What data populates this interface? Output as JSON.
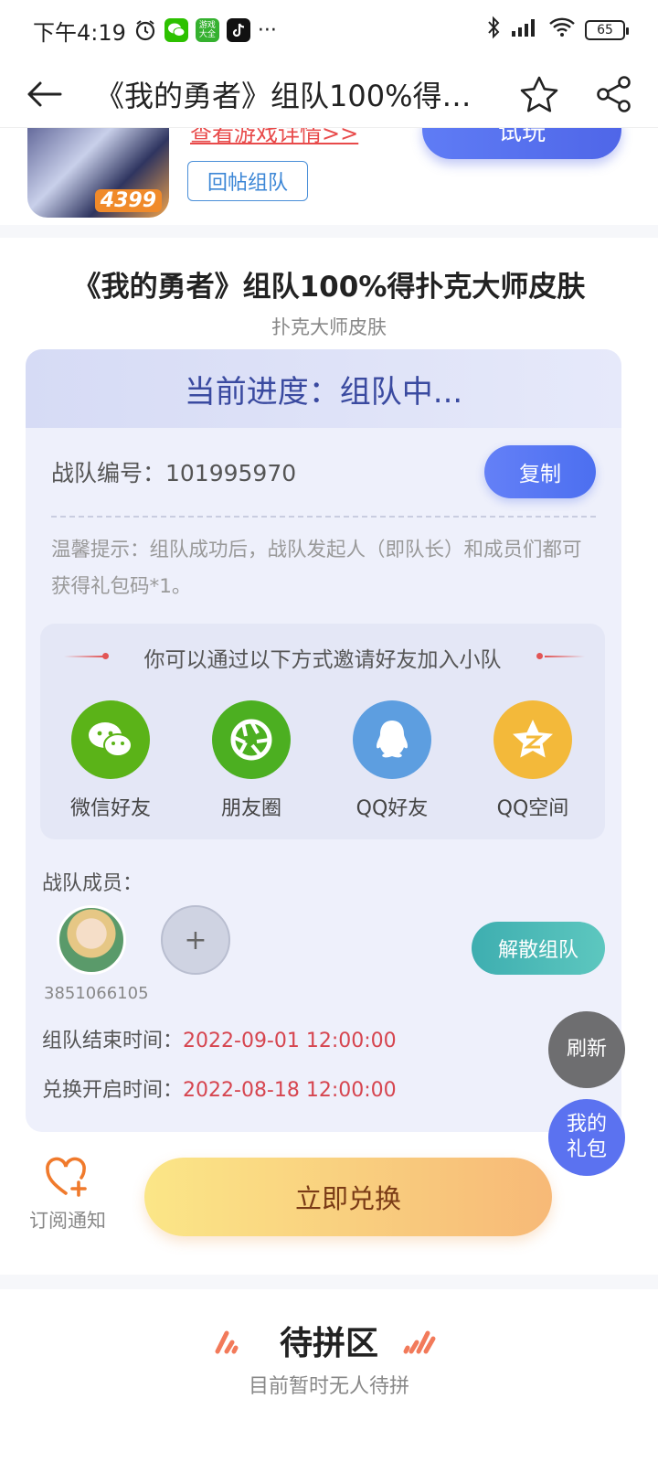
{
  "status_bar": {
    "time": "下午4:19",
    "app_badge_1": "游戏大全",
    "more": "···",
    "battery": "65"
  },
  "nav": {
    "title": "《我的勇者》组队100%得扑…"
  },
  "game": {
    "badge": "4399",
    "detail_link": "查看游戏详情>>",
    "trial_label": "试玩",
    "reply_team_label": "回帖组队"
  },
  "activity": {
    "title": "《我的勇者》组队100%得扑克大师皮肤",
    "subtitle": "扑克大师皮肤",
    "progress_label": "当前进度：组队中...",
    "team_id_label": "战队编号：101995970",
    "copy_label": "复制",
    "tip": "温馨提示：组队成功后，战队发起人（即队长）和成员们都可获得礼包码*1。"
  },
  "invite": {
    "title": "你可以通过以下方式邀请好友加入小队",
    "options": [
      {
        "label": "微信好友",
        "icon": "wechat-icon",
        "color": "#5bb318"
      },
      {
        "label": "朋友圈",
        "icon": "moments-icon",
        "color": "#4caf21"
      },
      {
        "label": "QQ好友",
        "icon": "qq-icon",
        "color": "#5d9ee0"
      },
      {
        "label": "QQ空间",
        "icon": "qzone-icon",
        "color": "#f3b93a"
      }
    ]
  },
  "members": {
    "label": "战队成员：",
    "items": [
      {
        "id": "3851066105"
      }
    ],
    "add_label": "+",
    "disband_label": "解散组队"
  },
  "times": {
    "end_label": "组队结束时间：",
    "end_value": "2022-09-01 12:00:00",
    "redeem_label": "兑换开启时间：",
    "redeem_value": "2022-08-18 12:00:00"
  },
  "float": {
    "refresh": "刷新",
    "my_gift": "我的礼包"
  },
  "actions": {
    "subscribe_label": "订阅通知",
    "redeem_label": "立即兑换"
  },
  "pending": {
    "title": "待拼区",
    "empty": "目前暂时无人待拼"
  },
  "colors": {
    "accent_blue": "#5f7cf5",
    "date_red": "#d6454f",
    "teal": "#4cbab6",
    "orange_icon": "#f07a2c"
  }
}
